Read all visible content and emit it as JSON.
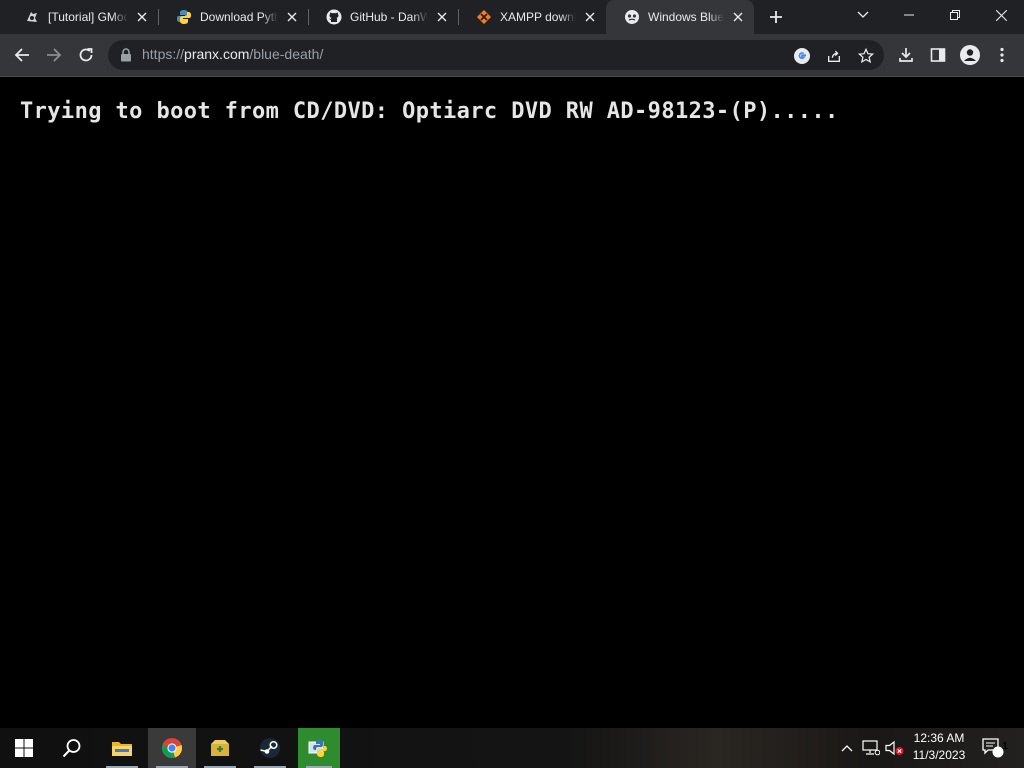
{
  "browser": {
    "tabs": [
      {
        "title": "[Tutorial] GMod",
        "favicon": "gmod-icon",
        "active": false
      },
      {
        "title": "Download Pyth",
        "favicon": "python-icon",
        "active": false
      },
      {
        "title": "GitHub - DanW",
        "favicon": "github-icon",
        "active": false
      },
      {
        "title": "XAMPP downlo",
        "favicon": "xampp-icon",
        "active": false
      },
      {
        "title": "Windows Blue",
        "favicon": "pranx-icon",
        "active": true
      }
    ],
    "address": {
      "scheme": "https://",
      "host": "pranx.com",
      "path": "/blue-death/"
    }
  },
  "page": {
    "boot_message": "Trying to boot from CD/DVD: Optiarc DVD RW AD-98123-(P)....."
  },
  "taskbar": {
    "apps": [
      "start-icon",
      "search-icon",
      "file-explorer-icon",
      "chrome-icon",
      "archive-icon",
      "steam-icon",
      "python-launcher-icon"
    ],
    "clock": {
      "time": "12:36 AM",
      "date": "11/3/2023"
    },
    "notification_count": "1"
  },
  "colors": {
    "tabstrip": "#202124",
    "toolbar": "#35363a",
    "omnibox": "#202124",
    "page_background": "#000000",
    "boot_text": "#e6e6e6"
  }
}
